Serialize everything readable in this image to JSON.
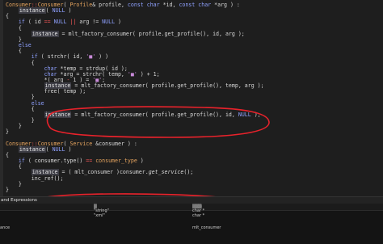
{
  "code_lines": [
    {
      "segments": [
        {
          "t": "Consumer",
          "c": "ty"
        },
        {
          "t": "::",
          "c": "sym"
        },
        {
          "t": "Consumer",
          "c": "ty"
        },
        {
          "t": "( ",
          "c": "fn"
        },
        {
          "t": "Profile",
          "c": "ty"
        },
        {
          "t": "& profile, ",
          "c": "fn"
        },
        {
          "t": "const ",
          "c": "kw"
        },
        {
          "t": "char ",
          "c": "kw"
        },
        {
          "t": "*id, ",
          "c": "fn"
        },
        {
          "t": "const ",
          "c": "kw"
        },
        {
          "t": "char ",
          "c": "kw"
        },
        {
          "t": "*arg ) :",
          "c": "fn"
        }
      ]
    },
    {
      "segments": [
        {
          "t": "    ",
          "c": "fn"
        },
        {
          "t": "instance",
          "c": "hl"
        },
        {
          "t": "( ",
          "c": "fn"
        },
        {
          "t": "NULL",
          "c": "kw"
        },
        {
          "t": " )",
          "c": "fn"
        }
      ]
    },
    {
      "segments": [
        {
          "t": "{",
          "c": "fn"
        }
      ]
    },
    {
      "segments": [
        {
          "t": "    ",
          "c": "fn"
        },
        {
          "t": "if",
          "c": "kw"
        },
        {
          "t": " ( id ",
          "c": "fn"
        },
        {
          "t": "==",
          "c": "sym"
        },
        {
          "t": " NULL ",
          "c": "kw"
        },
        {
          "t": "||",
          "c": "sym"
        },
        {
          "t": " arg != ",
          "c": "fn"
        },
        {
          "t": "NULL",
          "c": "kw"
        },
        {
          "t": " )",
          "c": "fn"
        }
      ]
    },
    {
      "segments": [
        {
          "t": "    {",
          "c": "fn"
        }
      ]
    },
    {
      "segments": [
        {
          "t": "        ",
          "c": "fn"
        },
        {
          "t": "instance",
          "c": "hl"
        },
        {
          "t": " = mlt_factory_consumer( profile.get_profile(), id, arg );",
          "c": "fn"
        }
      ]
    },
    {
      "segments": [
        {
          "t": "    }",
          "c": "fn"
        }
      ]
    },
    {
      "segments": [
        {
          "t": "    ",
          "c": "fn"
        },
        {
          "t": "else",
          "c": "kw"
        }
      ]
    },
    {
      "segments": [
        {
          "t": "    {",
          "c": "fn"
        }
      ]
    },
    {
      "segments": [
        {
          "t": "        ",
          "c": "fn"
        },
        {
          "t": "if",
          "c": "kw"
        },
        {
          "t": " ( strchr( id, ",
          "c": "fn"
        },
        {
          "t": "'■'",
          "c": "ph"
        },
        {
          "t": " ) )",
          "c": "fn"
        }
      ]
    },
    {
      "segments": [
        {
          "t": "        {",
          "c": "fn"
        }
      ]
    },
    {
      "segments": [
        {
          "t": "            ",
          "c": "fn"
        },
        {
          "t": "char ",
          "c": "kw"
        },
        {
          "t": "*temp = strdup( id );",
          "c": "fn"
        }
      ]
    },
    {
      "segments": [
        {
          "t": "            ",
          "c": "fn"
        },
        {
          "t": "char ",
          "c": "kw"
        },
        {
          "t": "*arg = strchr( temp, ",
          "c": "fn"
        },
        {
          "t": "'■'",
          "c": "ph"
        },
        {
          "t": " ) + 1;",
          "c": "fn"
        }
      ]
    },
    {
      "segments": [
        {
          "t": "            *( arg ",
          "c": "fn"
        },
        {
          "t": "-",
          "c": "sym"
        },
        {
          "t": " 1 ) = ",
          "c": "fn"
        },
        {
          "t": "'■'",
          "c": "ph"
        },
        {
          "t": ";",
          "c": "fn"
        }
      ]
    },
    {
      "segments": [
        {
          "t": "            ",
          "c": "fn"
        },
        {
          "t": "instance",
          "c": "hl"
        },
        {
          "t": " = mlt_factory_consumer( profile.get_profile(), temp, arg );",
          "c": "fn"
        }
      ]
    },
    {
      "segments": [
        {
          "t": "            free( temp );",
          "c": "fn"
        }
      ]
    },
    {
      "segments": [
        {
          "t": "        }",
          "c": "fn"
        }
      ]
    },
    {
      "segments": [
        {
          "t": "        ",
          "c": "fn"
        },
        {
          "t": "else",
          "c": "kw"
        }
      ]
    },
    {
      "segments": [
        {
          "t": "        {",
          "c": "fn"
        }
      ]
    },
    {
      "segments": [
        {
          "t": "            ",
          "c": "fn"
        },
        {
          "t": "instance",
          "c": "hl"
        },
        {
          "t": " = mlt_factory_consumer( profile.get_profile(), id, ",
          "c": "fn"
        },
        {
          "t": "NULL",
          "c": "kw"
        },
        {
          "t": " );",
          "c": "fn"
        }
      ]
    },
    {
      "segments": [
        {
          "t": "        }",
          "c": "fn"
        }
      ]
    },
    {
      "segments": [
        {
          "t": "    }",
          "c": "fn"
        }
      ]
    },
    {
      "segments": [
        {
          "t": "}",
          "c": "fn"
        }
      ]
    },
    {
      "segments": [
        {
          "t": "",
          "c": "fn"
        }
      ]
    },
    {
      "segments": [
        {
          "t": "Consumer",
          "c": "ty"
        },
        {
          "t": "::",
          "c": "sym"
        },
        {
          "t": "Consumer",
          "c": "ty"
        },
        {
          "t": "( ",
          "c": "fn"
        },
        {
          "t": "Service",
          "c": "ty"
        },
        {
          "t": " &consumer ) :",
          "c": "fn"
        }
      ]
    },
    {
      "segments": [
        {
          "t": "    ",
          "c": "fn"
        },
        {
          "t": "instance",
          "c": "hl"
        },
        {
          "t": "( ",
          "c": "fn"
        },
        {
          "t": "NULL",
          "c": "kw"
        },
        {
          "t": " )",
          "c": "fn"
        }
      ]
    },
    {
      "segments": [
        {
          "t": "{",
          "c": "fn"
        }
      ]
    },
    {
      "segments": [
        {
          "t": "    ",
          "c": "fn"
        },
        {
          "t": "if",
          "c": "kw"
        },
        {
          "t": " ( consumer.type() ",
          "c": "fn"
        },
        {
          "t": "==",
          "c": "sym"
        },
        {
          "t": " consumer_type ",
          "c": "ty"
        },
        {
          "t": ")",
          "c": "fn"
        }
      ]
    },
    {
      "segments": [
        {
          "t": "    {",
          "c": "fn"
        }
      ]
    },
    {
      "segments": [
        {
          "t": "        ",
          "c": "fn"
        },
        {
          "t": "instance",
          "c": "hl"
        },
        {
          "t": " = ( mlt_consumer )consumer.",
          "c": "fn"
        },
        {
          "t": "get_service",
          "c": "it"
        },
        {
          "t": "();",
          "c": "fn"
        }
      ]
    },
    {
      "segments": [
        {
          "t": "        inc_ref();",
          "c": "fn"
        }
      ]
    },
    {
      "segments": [
        {
          "t": "    }",
          "c": "fn"
        }
      ]
    },
    {
      "segments": [
        {
          "t": "}",
          "c": "fn"
        }
      ]
    }
  ],
  "watch_panel": {
    "title": "and Expressions",
    "headers": [
      "▒",
      "▒▒▒"
    ],
    "rows": [
      {
        "name": "",
        "value": "\"string\"",
        "type": "char *"
      },
      {
        "name": "",
        "value": "\"xml\"",
        "type": "char *"
      },
      {
        "name": "",
        "value": "",
        "type": ""
      },
      {
        "name": "ance",
        "value": "",
        "type": "mlt_consumer"
      }
    ]
  },
  "colors": {
    "background": "#1e1e1e",
    "annotation_circle": "#e8222b",
    "keyword": "#8fa1ff",
    "type": "#e4a35e"
  }
}
